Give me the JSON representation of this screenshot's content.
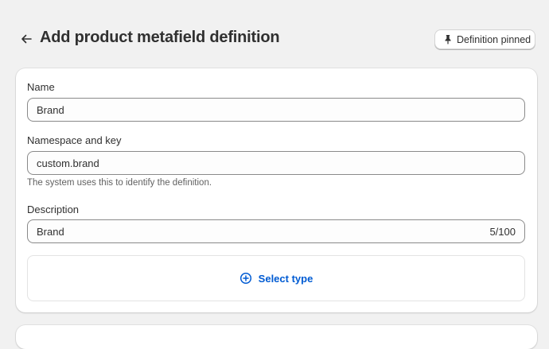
{
  "header": {
    "title": "Add product metafield definition",
    "back_icon": "arrow-left-icon",
    "pin_button_label": "Definition pinned",
    "pin_icon": "pin-icon"
  },
  "form": {
    "name": {
      "label": "Name",
      "value": "Brand"
    },
    "namespace": {
      "label": "Namespace and key",
      "value": "custom.brand",
      "help": "The system uses this to identify the definition."
    },
    "description": {
      "label": "Description",
      "value": "Brand",
      "counter": "5/100"
    },
    "select_type": {
      "label": "Select type",
      "icon": "plus-circle-icon"
    }
  },
  "colors": {
    "background": "#f1f1f1",
    "card": "#ffffff",
    "accent": "#005bd3",
    "text": "#303030",
    "muted": "#616161"
  }
}
